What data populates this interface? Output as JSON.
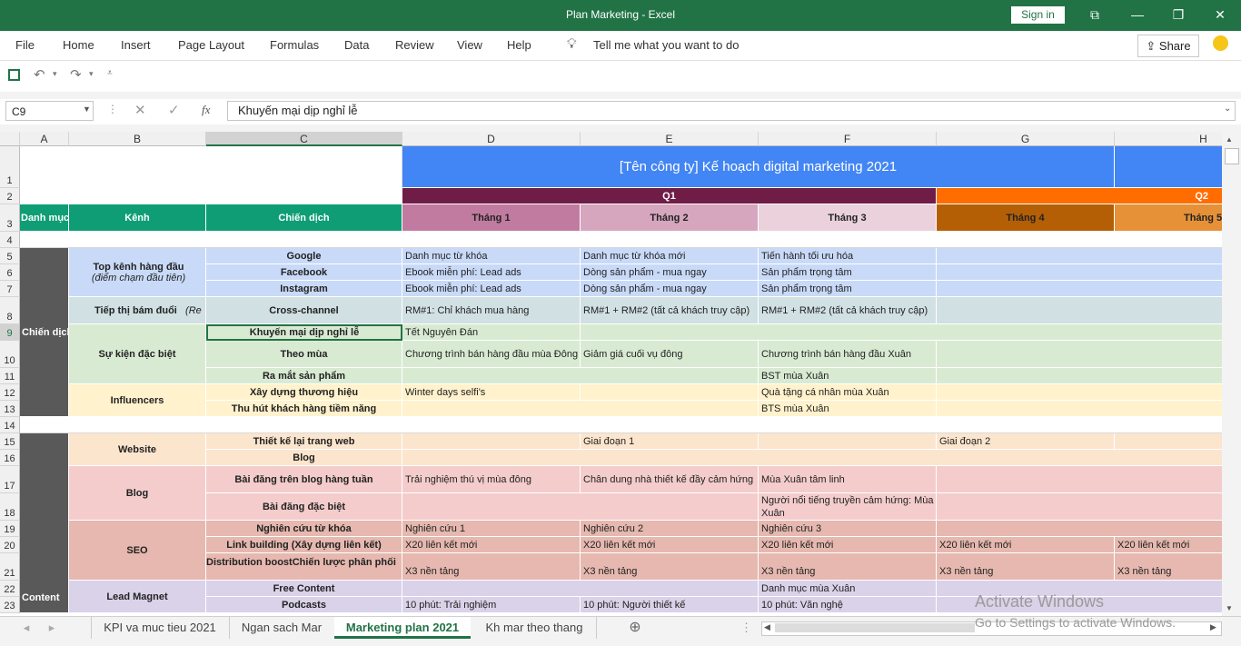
{
  "window": {
    "title": "Plan Marketing  -  Excel",
    "signin": "Sign in",
    "minimize": "🗖",
    "restore": "❐",
    "close": "✕"
  },
  "menu": [
    "File",
    "Home",
    "Insert",
    "Page Layout",
    "Formulas",
    "Data",
    "Review",
    "View",
    "Help"
  ],
  "tellme": "Tell me what you want to do",
  "share": "Share",
  "formula": {
    "namebox": "C9",
    "content": "Khuyến mại dịp nghỉ lễ"
  },
  "columns": [
    "A",
    "B",
    "C",
    "D",
    "E",
    "F",
    "G",
    "H"
  ],
  "rows": [
    "1",
    "2",
    "3",
    "4",
    "5",
    "6",
    "7",
    "8",
    "9",
    "10",
    "11",
    "12",
    "13",
    "14",
    "15",
    "16",
    "17",
    "18",
    "19",
    "20",
    "21",
    "22",
    "23"
  ],
  "sheet": {
    "title": "[Tên công ty] Kế hoạch digital marketing 2021",
    "q1": "Q1",
    "q2": "Q2",
    "headers": {
      "category": "Danh mục",
      "channel": "Kênh",
      "campaign": "Chiến dịch",
      "m1": "Tháng 1",
      "m2": "Tháng 2",
      "m3": "Tháng 3",
      "m4": "Tháng 4",
      "m5": "Tháng 5"
    },
    "cat_campaign": "Chiến dịch",
    "cat_content": "Content",
    "ch_top": "Top kênh hàng đầu",
    "ch_top_sub": "(điểm chạm đầu tiên)",
    "ch_retarget": "Tiếp thị bám đuổi",
    "ch_retarget_sub": "(Re",
    "ch_event": "Sự kiện đặc biệt",
    "ch_influencer": "Influencers",
    "ch_website": "Website",
    "ch_blog": "Blog",
    "ch_seo": "SEO",
    "ch_lead": "Lead Magnet",
    "r5": {
      "c": "Google",
      "d": "Danh mục từ khóa",
      "e": "Danh mục từ khóa mới",
      "f": "Tiến hành tối ưu hóa"
    },
    "r6": {
      "c": "Facebook",
      "d": "Ebook miễn phí: Lead ads",
      "e": "Dòng sản phẩm - mua ngay",
      "f": "Sản phẩm trọng tâm"
    },
    "r7": {
      "c": "Instagram",
      "d": "Ebook miễn phí: Lead ads",
      "e": "Dòng sản phẩm - mua ngay",
      "f": "Sản phẩm trọng tâm"
    },
    "r8": {
      "c": "Cross-channel",
      "d": "RM#1: Chỉ khách mua hàng",
      "e": "RM#1 + RM#2 (tất cả khách truy cập)",
      "f": "RM#1 + RM#2 (tất cả khách truy cập)"
    },
    "r9": {
      "c": "Khuyến mại dịp nghỉ lễ",
      "d": "Tết Nguyên Đán"
    },
    "r10": {
      "c": "Theo mùa",
      "d": "Chương trình bán hàng đầu mùa Đông",
      "e": "Giảm giá cuối vụ đông",
      "f": "Chương trình bán hàng đầu Xuân"
    },
    "r11": {
      "c": "Ra mắt sản phẩm",
      "f": "BST mùa Xuân"
    },
    "r12": {
      "c": "Xây dựng thương hiệu",
      "d": "Winter days selfi's",
      "f": "Quà tặng cá nhân mùa Xuân"
    },
    "r13": {
      "c": "Thu hút khách hàng tiềm năng",
      "f": "BTS mùa Xuân"
    },
    "r15": {
      "c": "Thiết kế lại trang web",
      "e": "Giai đoạn 1",
      "g": "Giai đoạn 2"
    },
    "r16": {
      "c": "Blog"
    },
    "r17": {
      "c": "Bài đăng trên blog hàng tuần",
      "d": "Trải nghiệm thú vị mùa đông",
      "e": "Chân dung nhà thiết kế đầy cảm hứng",
      "f": "Mùa Xuân tâm linh"
    },
    "r18": {
      "c": "Bài đăng đặc biệt",
      "f1": "Người nổi tiếng truyền cảm hứng: Mùa",
      "f2": "Xuân"
    },
    "r19": {
      "c": "Nghiên cứu từ khóa",
      "d": "Nghiên cứu 1",
      "e": "Nghiên cứu 2",
      "f": "Nghiên cứu 3"
    },
    "r20": {
      "c": "Link building (Xây dựng liên kết)",
      "d": "X20 liên kết mới",
      "e": "X20 liên kết mới",
      "f": "X20 liên kết mới",
      "g": "X20 liên kết mới",
      "h": "X20 liên kết mới"
    },
    "r21": {
      "c": "Distribution boostChiến lược phân phối",
      "d": "X3 nền tảng",
      "e": "X3 nền tảng",
      "f": "X3 nền tảng",
      "g": "X3 nền tảng",
      "h": "X3 nền tảng"
    },
    "r22": {
      "c": "Free Content",
      "f": "Danh mục mùa Xuân"
    },
    "r23": {
      "c": "Podcasts",
      "d": "10 phút: Trải nghiệm",
      "e": "10 phút: Người thiết kế",
      "f": "10 phút: Văn nghệ"
    }
  },
  "tabs": [
    "KPI va muc tieu 2021",
    "Ngan sach Mar",
    "Marketing plan 2021",
    "Kh mar theo thang"
  ],
  "watermark": {
    "line1": "Activate Windows",
    "line2": "Go to Settings to activate Windows."
  },
  "colors": {
    "excel_green": "#217346",
    "title_blue": "#4285f4",
    "q1": "#6f1d46",
    "q2": "#ff6d01",
    "header_green": "#0f9d75"
  }
}
